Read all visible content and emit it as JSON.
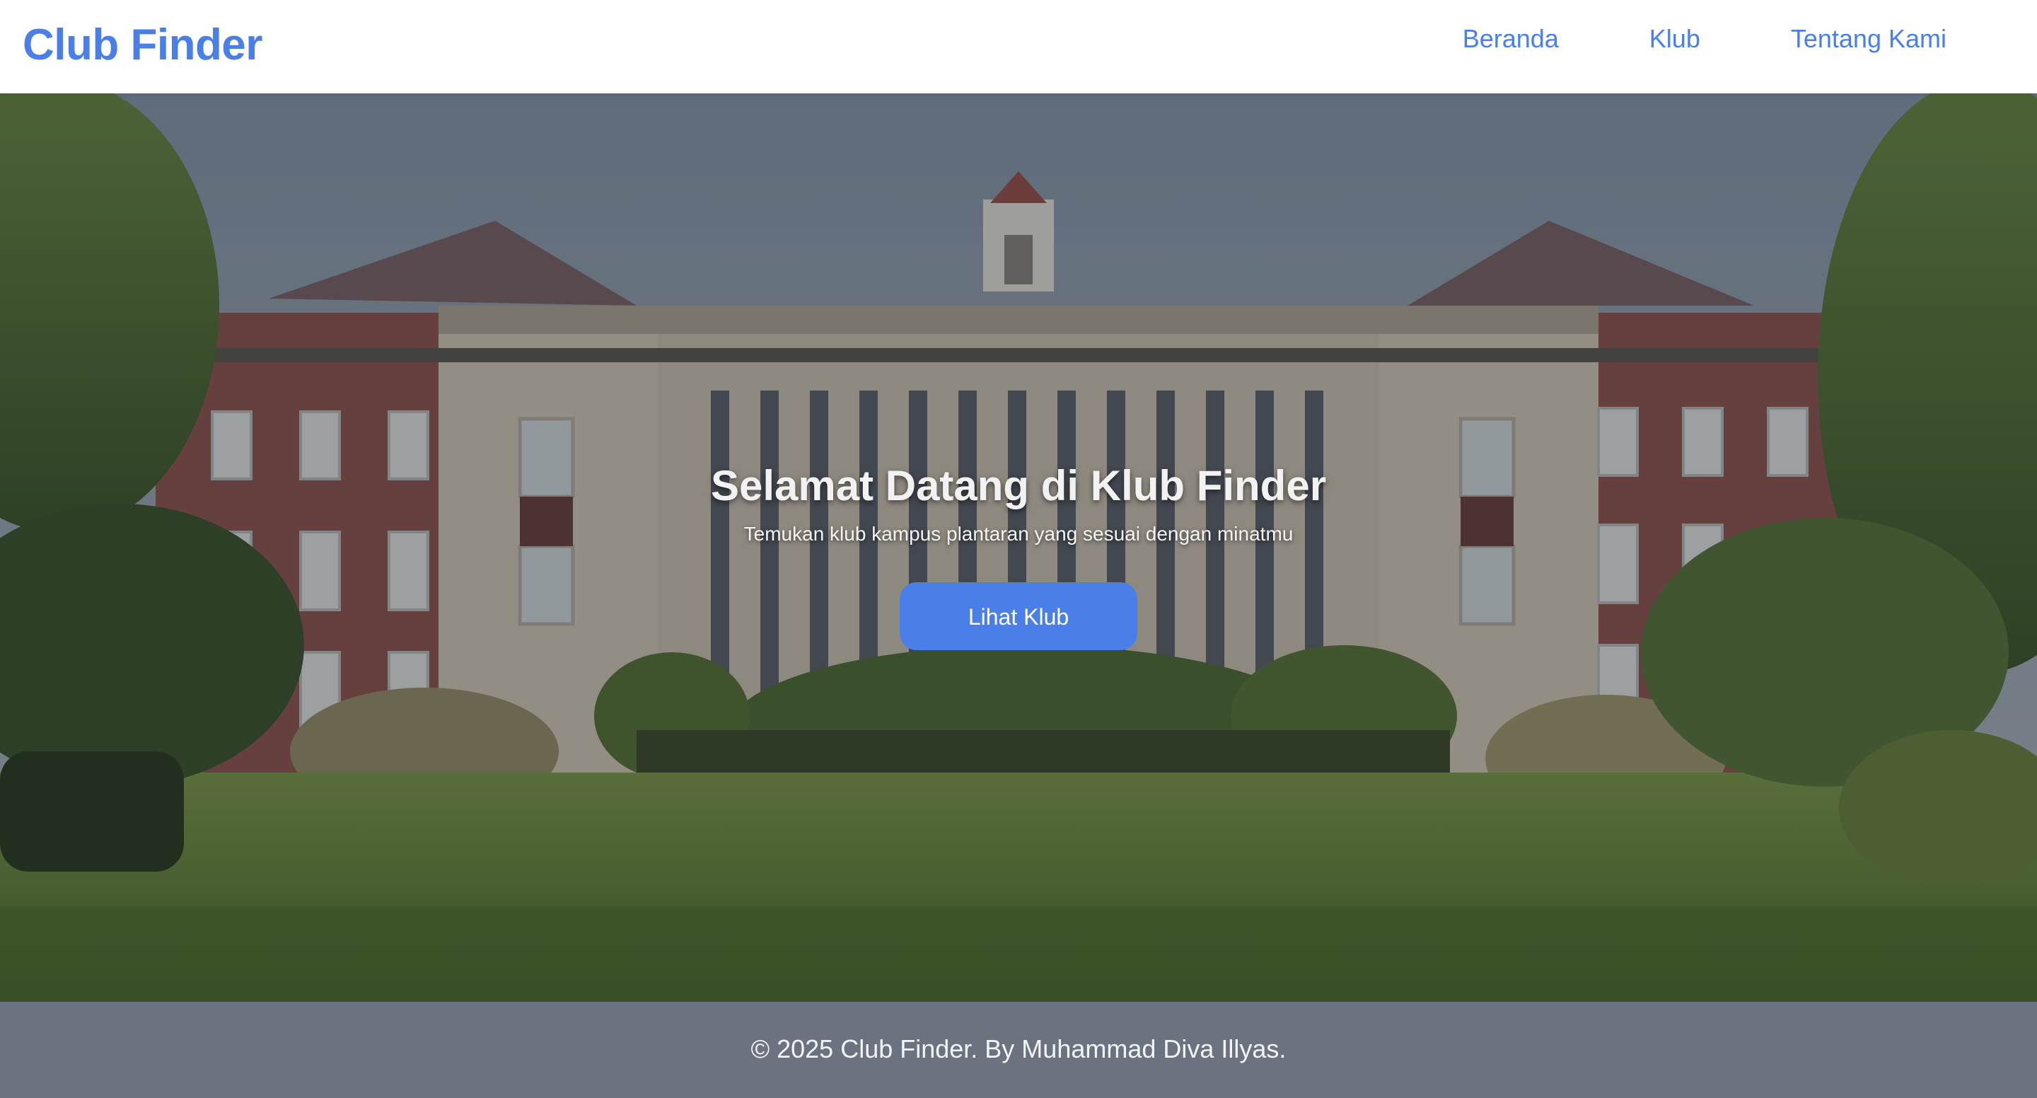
{
  "navbar": {
    "brand": "Club Finder",
    "links": [
      {
        "label": "Beranda"
      },
      {
        "label": "Klub"
      },
      {
        "label": "Tentang Kami"
      }
    ]
  },
  "hero": {
    "title": "Selamat Datang di Klub Finder",
    "subtitle": "Temukan klub kampus plantaran yang sesuai dengan minatmu",
    "button_label": "Lihat Klub"
  },
  "footer": {
    "text": "© 2025 Club Finder. By Muhammad Diva Illyas."
  },
  "colors": {
    "accent": "#4a7fe8",
    "footer_bg": "#6b7280",
    "hero_overlay": "rgba(20,28,40,0.35)"
  }
}
